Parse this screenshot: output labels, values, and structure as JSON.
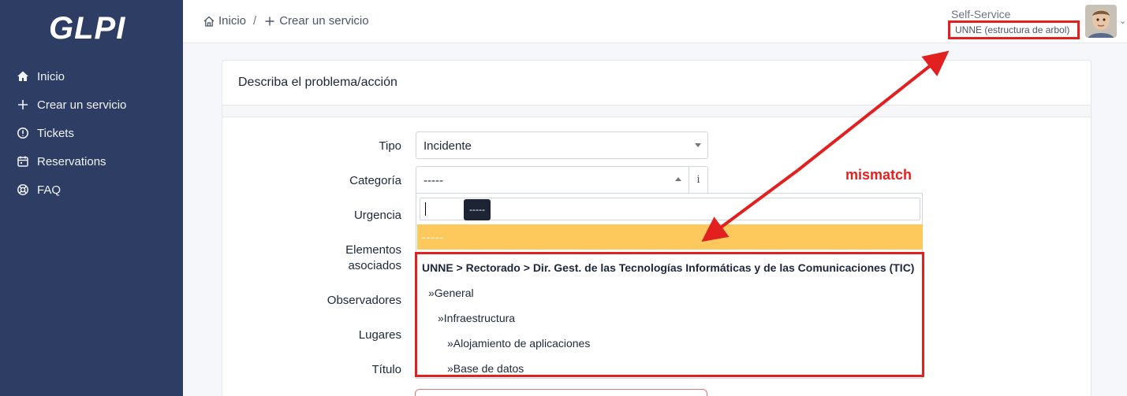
{
  "sidebar": {
    "logo": "GLPI",
    "items": [
      {
        "label": "Inicio",
        "icon": "home-icon"
      },
      {
        "label": "Crear un servicio",
        "icon": "plus-icon"
      },
      {
        "label": "Tickets",
        "icon": "alert-circle-icon"
      },
      {
        "label": "Reservations",
        "icon": "calendar-icon"
      },
      {
        "label": "FAQ",
        "icon": "lifebuoy-icon"
      }
    ]
  },
  "header": {
    "breadcrumb": [
      {
        "label": "Inicio",
        "icon": "home-icon"
      },
      {
        "label": "Crear un servicio",
        "icon": "plus-icon"
      }
    ],
    "profile": "Self-Service",
    "entity": "UNNE (estructura de arbol)"
  },
  "form": {
    "title": "Describa el problema/acción",
    "labels": {
      "tipo": "Tipo",
      "categoria": "Categoría",
      "urgencia": "Urgencia",
      "elementos_1": "Elementos",
      "elementos_2": "asociados",
      "observadores": "Observadores",
      "lugares": "Lugares",
      "titulo": "Título"
    },
    "tipo_value": "Incidente",
    "categoria_value": "-----",
    "info_icon": "i"
  },
  "dropdown": {
    "search_value": "",
    "tooltip": "-----",
    "highlighted": "-----",
    "options": [
      {
        "label": "UNNE > Rectorado > Dir. Gest. de las Tecnologías Informáticas y de las Comunicaciones (TIC)",
        "group": true
      },
      {
        "label": "»General",
        "level": 1
      },
      {
        "label": "»Infraestructura",
        "level": 2
      },
      {
        "label": "»Alojamiento de aplicaciones",
        "level": 3
      },
      {
        "label": "»Base de datos",
        "level": 3
      }
    ]
  },
  "annotation": {
    "text": "mismatch",
    "color": "#e32020"
  },
  "colors": {
    "sidebar_bg": "#2e3d63",
    "highlight": "#fec95c",
    "annotation_red": "#e32020"
  }
}
